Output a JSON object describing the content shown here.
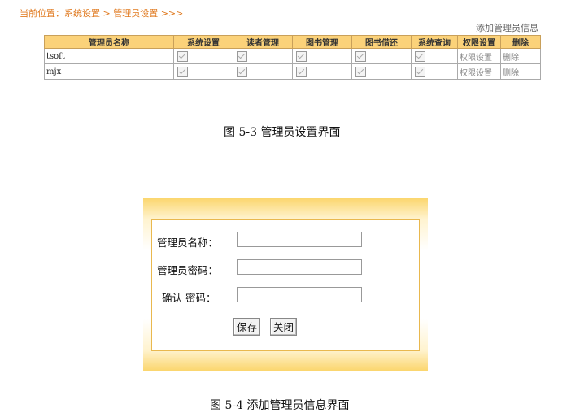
{
  "figure1": {
    "breadcrumb": "当前位置：系统设置 > 管理员设置 >>>",
    "add_link": "添加管理员信息",
    "columns": [
      "管理员名称",
      "系统设置",
      "读者管理",
      "图书管理",
      "图书借还",
      "系统查询",
      "权限设置",
      "删除"
    ],
    "rows": [
      {
        "name": "tsoft",
        "perm": "权限设置",
        "del": "删除"
      },
      {
        "name": "mjx",
        "perm": "权限设置",
        "del": "删除"
      }
    ],
    "caption": "图 5-3  管理员设置界面"
  },
  "figure2": {
    "fields": [
      {
        "label": "管理员名称：",
        "value": ""
      },
      {
        "label": "管理员密码：",
        "value": ""
      },
      {
        "label": "确认  密码：",
        "value": ""
      }
    ],
    "save_label": "保存",
    "close_label": "关闭",
    "caption": "图 5-4  添加管理员信息界面"
  }
}
